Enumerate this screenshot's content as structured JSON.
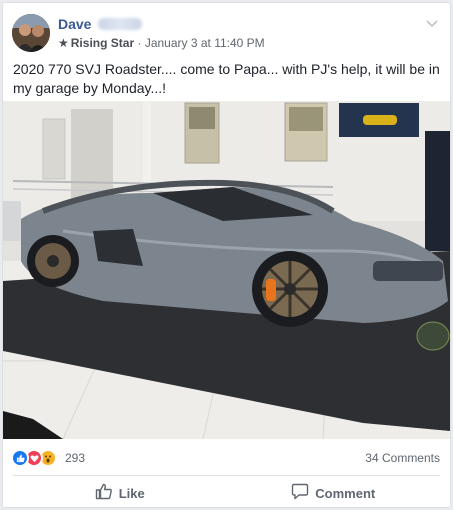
{
  "post": {
    "author": "Dave",
    "badge": "Rising Star",
    "timestamp": "January 3 at 11:40 PM",
    "separator": "·",
    "text": "2020 770 SVJ Roadster.... come to Papa... with PJ's help, it will be in my garage by Monday...!"
  },
  "stats": {
    "reactions_count": "293",
    "comments_count": "34 Comments"
  },
  "actions": {
    "like_label": "Like",
    "comment_label": "Comment"
  },
  "icons": {
    "like_icon": "thumbs-up-icon",
    "comment_icon": "speech-bubble-icon",
    "menu_icon": "chevron-down-icon",
    "badge_icon": "star-icon"
  },
  "colors": {
    "link_blue": "#385898",
    "like_blue": "#1877f2",
    "love_red": "#f33e58",
    "wow_yellow": "#f7b125",
    "secondary_text": "#606770"
  }
}
